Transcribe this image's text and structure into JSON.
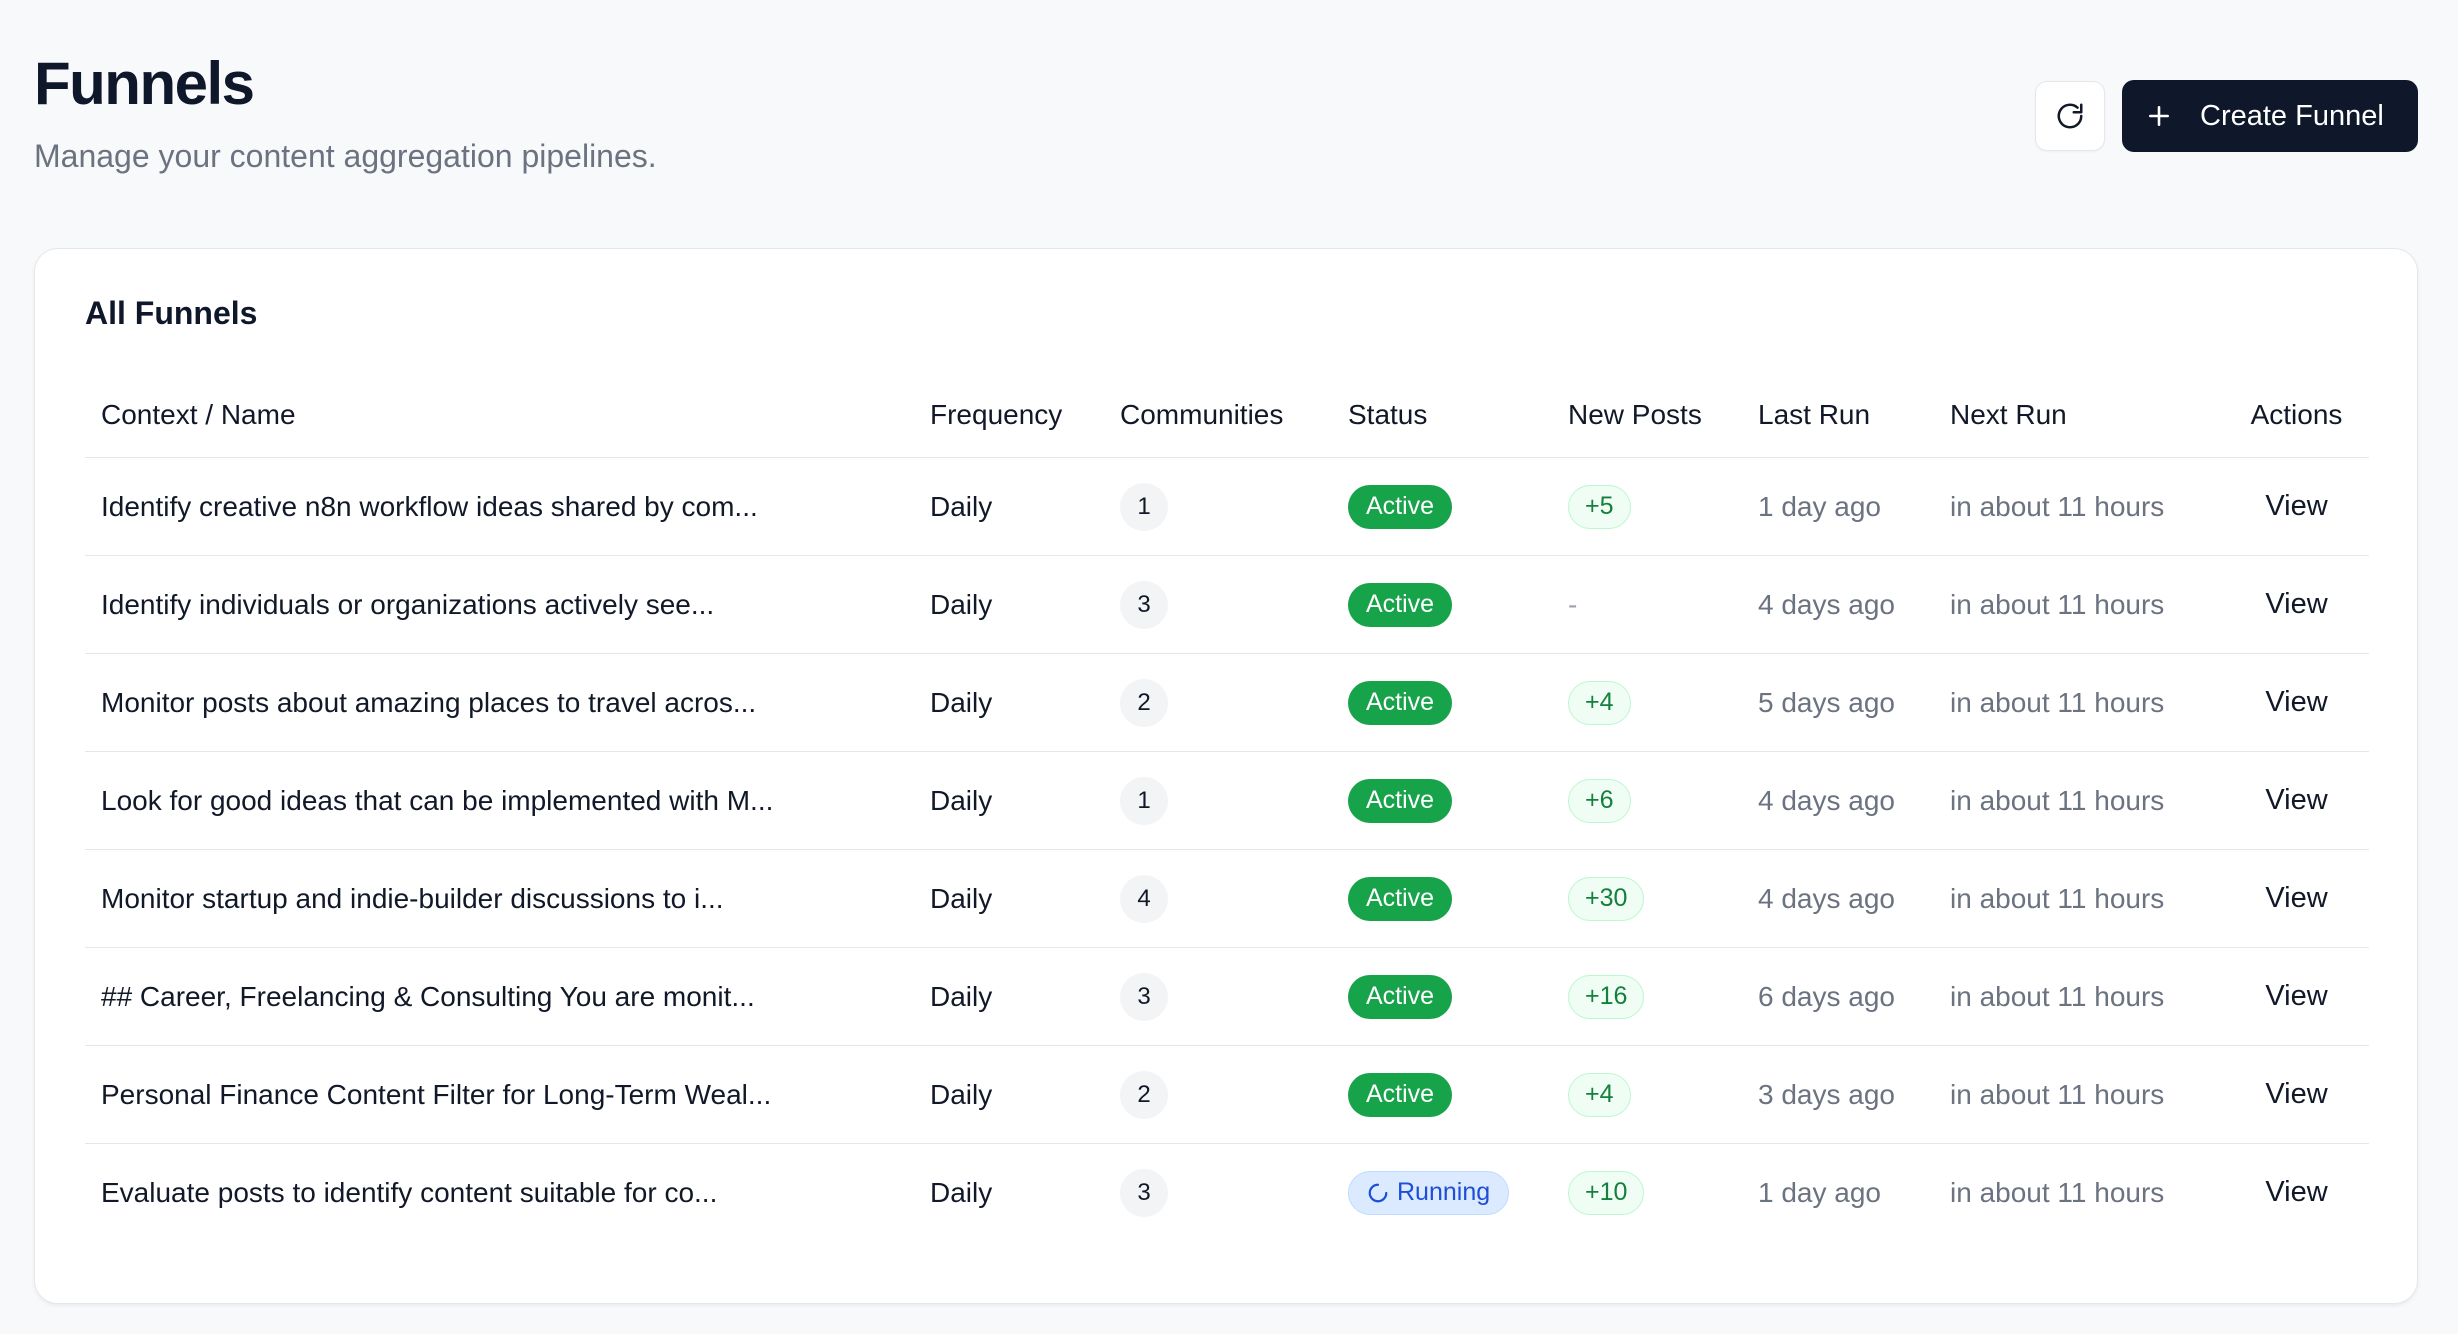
{
  "header": {
    "title": "Funnels",
    "subtitle": "Manage your content aggregation pipelines.",
    "create_label": "Create Funnel"
  },
  "card": {
    "title": "All Funnels"
  },
  "table": {
    "columns": [
      "Context / Name",
      "Frequency",
      "Communities",
      "Status",
      "New Posts",
      "Last Run",
      "Next Run",
      "Actions"
    ],
    "rows": [
      {
        "name": "Identify creative n8n workflow ideas shared by com...",
        "frequency": "Daily",
        "communities": "1",
        "status": "Active",
        "status_kind": "active",
        "new_posts": "+5",
        "last_run": "1 day ago",
        "next_run": "in about 11 hours",
        "action": "View"
      },
      {
        "name": "Identify individuals or organizations actively see...",
        "frequency": "Daily",
        "communities": "3",
        "status": "Active",
        "status_kind": "active",
        "new_posts": "-",
        "last_run": "4 days ago",
        "next_run": "in about 11 hours",
        "action": "View"
      },
      {
        "name": "Monitor posts about amazing places to travel acros...",
        "frequency": "Daily",
        "communities": "2",
        "status": "Active",
        "status_kind": "active",
        "new_posts": "+4",
        "last_run": "5 days ago",
        "next_run": "in about 11 hours",
        "action": "View"
      },
      {
        "name": "Look for good ideas that can be implemented with M...",
        "frequency": "Daily",
        "communities": "1",
        "status": "Active",
        "status_kind": "active",
        "new_posts": "+6",
        "last_run": "4 days ago",
        "next_run": "in about 11 hours",
        "action": "View"
      },
      {
        "name": "Monitor startup and indie-builder discussions to i...",
        "frequency": "Daily",
        "communities": "4",
        "status": "Active",
        "status_kind": "active",
        "new_posts": "+30",
        "last_run": "4 days ago",
        "next_run": "in about 11 hours",
        "action": "View"
      },
      {
        "name": "## Career, Freelancing & Consulting You are monit...",
        "frequency": "Daily",
        "communities": "3",
        "status": "Active",
        "status_kind": "active",
        "new_posts": "+16",
        "last_run": "6 days ago",
        "next_run": "in about 11 hours",
        "action": "View"
      },
      {
        "name": "Personal Finance Content Filter for Long-Term Weal...",
        "frequency": "Daily",
        "communities": "2",
        "status": "Active",
        "status_kind": "active",
        "new_posts": "+4",
        "last_run": "3 days ago",
        "next_run": "in about 11 hours",
        "action": "View"
      },
      {
        "name": "Evaluate posts to identify content suitable for co...",
        "frequency": "Daily",
        "communities": "3",
        "status": "Running",
        "status_kind": "running",
        "new_posts": "+10",
        "last_run": "1 day ago",
        "next_run": "in about 11 hours",
        "action": "View"
      }
    ]
  },
  "icons": {
    "refresh": "refresh-icon",
    "plus": "plus-icon",
    "running": "spinner-icon"
  },
  "colors": {
    "primary": "#0f172a",
    "active": "#16a34a",
    "running_bg": "#dbeafe",
    "running_text": "#1d4ed8",
    "posts_text": "#15803d"
  }
}
